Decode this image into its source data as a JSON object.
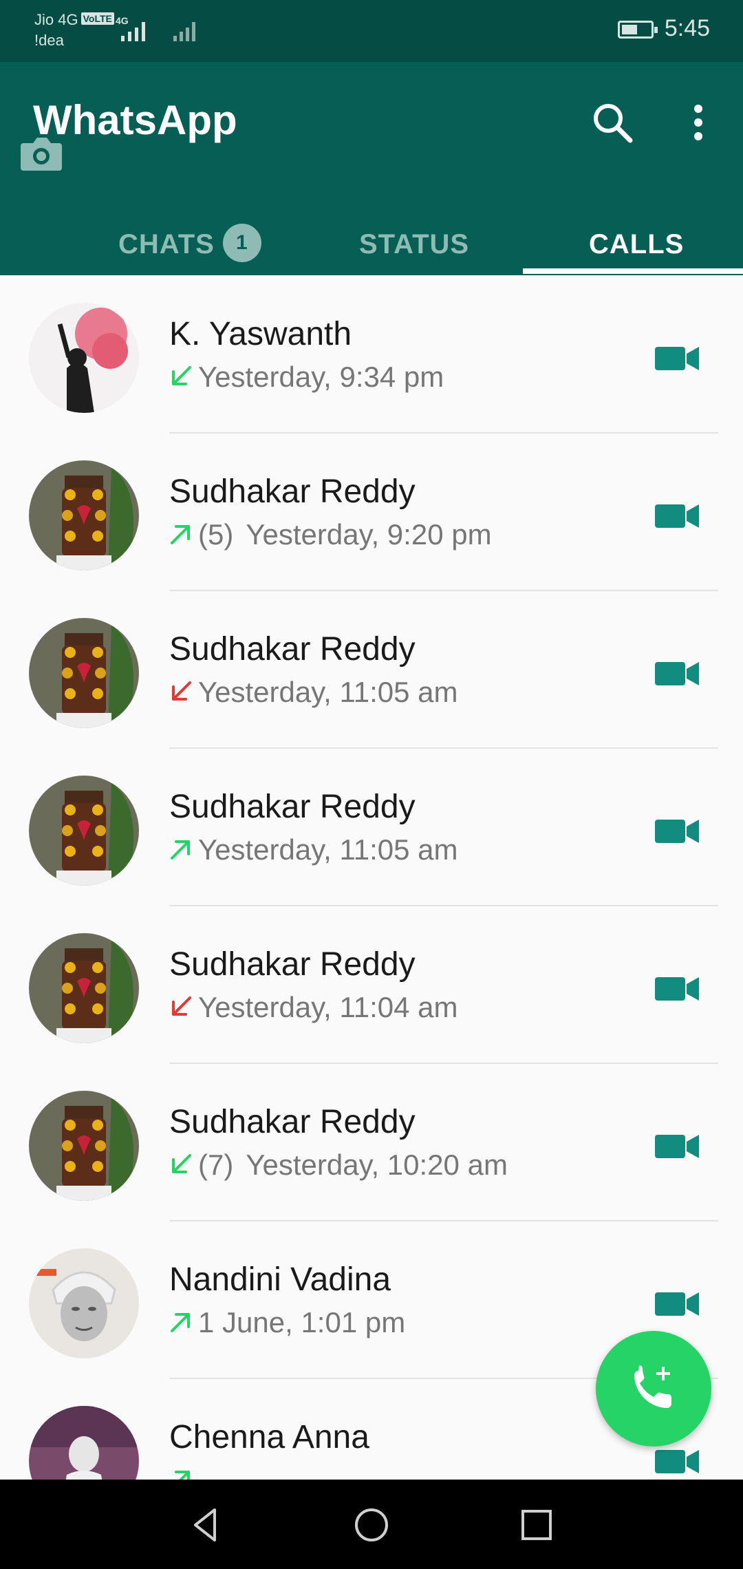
{
  "status_bar": {
    "carrier1": "Jio 4G",
    "volte": "VoLTE",
    "net": "4G",
    "carrier2": "!dea",
    "time": "5:45"
  },
  "app": {
    "title": "WhatsApp",
    "colors": {
      "header": "#075e54",
      "status_bar": "#054d44",
      "accent": "#25d366",
      "video": "#128c7e",
      "missed": "#e53935"
    }
  },
  "tabs": {
    "chats": "CHATS",
    "chats_badge": "1",
    "status": "STATUS",
    "calls": "CALLS"
  },
  "calls": [
    {
      "name": "K. Yaswanth",
      "direction": "incoming",
      "count": "",
      "time": "Yesterday, 9:34 pm",
      "avatar": "flare-photo"
    },
    {
      "name": "Sudhakar Reddy",
      "direction": "outgoing",
      "count": "(5)",
      "time": "Yesterday, 9:20 pm",
      "avatar": "shrine-photo"
    },
    {
      "name": "Sudhakar Reddy",
      "direction": "missed",
      "count": "",
      "time": "Yesterday, 11:05 am",
      "avatar": "shrine-photo"
    },
    {
      "name": "Sudhakar Reddy",
      "direction": "outgoing",
      "count": "",
      "time": "Yesterday, 11:05 am",
      "avatar": "shrine-photo"
    },
    {
      "name": "Sudhakar Reddy",
      "direction": "missed",
      "count": "",
      "time": "Yesterday, 11:04 am",
      "avatar": "shrine-photo"
    },
    {
      "name": "Sudhakar Reddy",
      "direction": "incoming",
      "count": "(7)",
      "time": "Yesterday, 10:20 am",
      "avatar": "shrine-photo"
    },
    {
      "name": "Nandini Vadina",
      "direction": "outgoing",
      "count": "",
      "time": "1 June, 1:01 pm",
      "avatar": "saint-photo"
    },
    {
      "name": "Chenna Anna",
      "direction": "outgoing",
      "count": "",
      "time": "",
      "avatar": "statue-photo"
    }
  ]
}
